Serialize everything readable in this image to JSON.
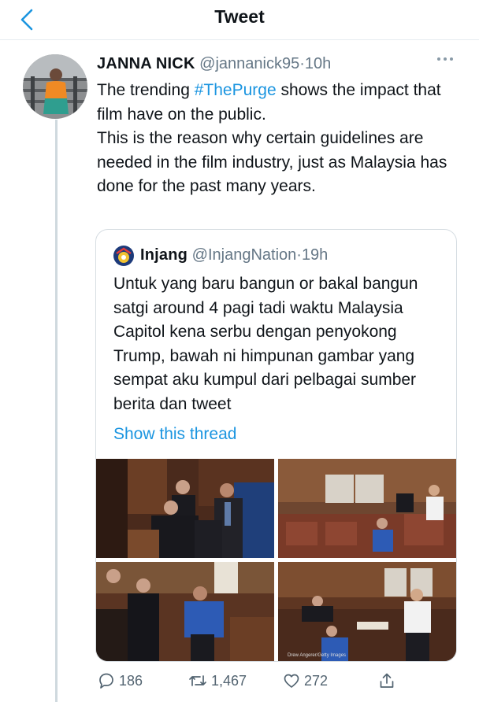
{
  "header": {
    "title": "Tweet"
  },
  "tweet": {
    "author_name": "JANNA NICK",
    "handle": "@jannanick95",
    "separator": "·",
    "time": "10h",
    "text_before_tag": "The trending ",
    "hashtag": "#ThePurge",
    "text_after_tag": " shows the impact that film have on the public.",
    "text_line2": "This is the reason why certain guidelines are needed in the film industry, just as Malaysia has done for the past many years."
  },
  "quote": {
    "author_name": "Injang",
    "handle": "@InjangNation",
    "separator": "·",
    "time": "19h",
    "text": "Untuk yang baru bangun or bakal bangun satgi around 4 pagi tadi waktu Malaysia Capitol kena serbu dengan penyokong Trump, bawah ni himpunan gambar yang sempat aku kumpul dari pelbagai sumber berita dan tweet",
    "show_thread": "Show this thread",
    "photo_credit": "Drew Angerer/Getty Images"
  },
  "actions": {
    "replies": "186",
    "retweets": "1,467",
    "likes": "272"
  },
  "colors": {
    "link": "#1b95e0",
    "secondary_text": "#657786",
    "border": "#d6dde2"
  }
}
